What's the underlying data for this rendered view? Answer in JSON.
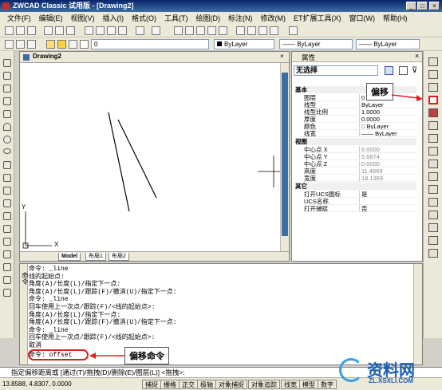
{
  "window": {
    "title": "ZWCAD Classic 试用版 - [Drawing2]"
  },
  "menu": [
    "文件(F)",
    "编辑(E)",
    "视图(V)",
    "插入(I)",
    "格式(O)",
    "工具(T)",
    "绘图(D)",
    "标注(N)",
    "修改(M)",
    "ET扩展工具(X)",
    "窗口(W)",
    "帮助(H)"
  ],
  "layers": {
    "current": "0"
  },
  "linetype": {
    "color": "ByLayer",
    "linetype": "—— ByLayer",
    "lineweight": "—— ByLayer"
  },
  "drawing": {
    "tab": "Drawing2",
    "axis_y": "Y",
    "axis_x": "X",
    "layout_tabs": [
      "Model",
      "布局1",
      "布局2"
    ]
  },
  "properties": {
    "title": "属性",
    "selection": "无选择",
    "groups": [
      {
        "name": "基本",
        "rows": [
          [
            "图层",
            "0"
          ],
          [
            "线型",
            "ByLayer"
          ],
          [
            "线型比例",
            "1.0000"
          ],
          [
            "厚度",
            "0.0000"
          ],
          [
            "颜色",
            "□ ByLayer"
          ],
          [
            "线宽",
            "—— ByLayer"
          ]
        ]
      },
      {
        "name": "视图",
        "rows": [
          [
            "中心点 X",
            "6.0000"
          ],
          [
            "中心点 Y",
            "5.6874"
          ],
          [
            "中心点 Z",
            "0.0000"
          ],
          [
            "高度",
            "11.4669"
          ],
          [
            "宽度",
            "18.1369"
          ]
        ]
      },
      {
        "name": "其它",
        "rows": [
          [
            "打开UCS图标",
            "是"
          ],
          [
            "UCS名称",
            ""
          ],
          [
            "打开捕捉",
            "否"
          ]
        ]
      }
    ]
  },
  "command": {
    "side_label": "命令",
    "lines": [
      "命令: _line",
      "线的起始点:",
      "角度(A)/长度(L)/指定下一点:",
      "角度(A)/长度(L)/跟踪(F)/撤消(U)/指定下一点:",
      "命令: _line",
      "回车使用上一次点/跟踪(F)/<线的起始点>:",
      "角度(A)/长度(L)/指定下一点:",
      "角度(A)/长度(L)/跟踪(F)/撤消(U)/指定下一点:",
      "命令: _line",
      "回车使用上一次点/跟踪(F)/<线的起始点>:",
      "取消",
      "命令: offset"
    ],
    "prompt": "指定偏移距离或 [通过(T)/拖拽(D)/删除(E)/图层(L)] <拖拽>:"
  },
  "status": {
    "coords": "13.8588, 4.8307, 0.0000",
    "buttons": [
      "捕捉",
      "栅格",
      "正交",
      "极轴",
      "对象捕捉",
      "对象追踪",
      "线宽",
      "模型",
      "数字"
    ]
  },
  "annotations": {
    "offset_tool": "偏移",
    "offset_command": "偏移命令"
  },
  "watermark": {
    "text": "资料网",
    "url": "ZL.XSXLI.COM"
  },
  "colors": {
    "highlight_red": "#e02020",
    "title_blue": "#0a246a"
  }
}
